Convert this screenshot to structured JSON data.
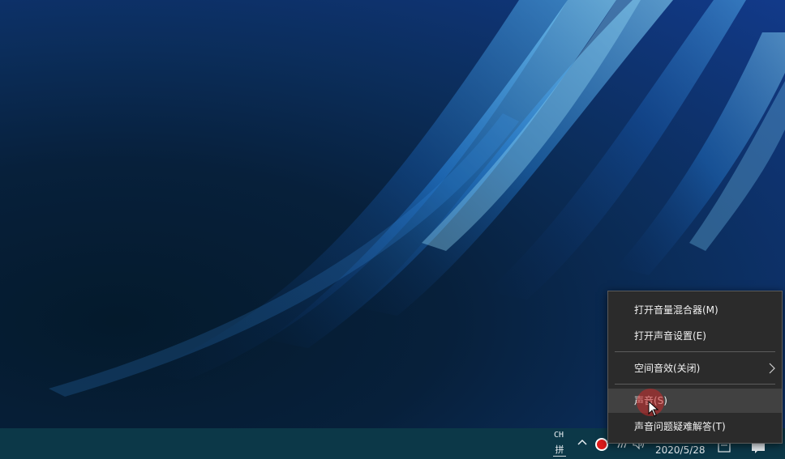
{
  "menu": {
    "items": [
      {
        "label": "打开音量混合器(M)"
      },
      {
        "label": "打开声音设置(E)"
      },
      {
        "label": "空间音效(关闭)"
      },
      {
        "label": "声音(S)"
      },
      {
        "label": "声音问题疑难解答(T)"
      }
    ]
  },
  "tray": {
    "ime_lang": "CH",
    "ime_mode": "拼",
    "time": "",
    "date": "2020/5/28"
  },
  "icons": {
    "chevron": "chevron-up-icon",
    "record": "record-icon",
    "network": "network-icon",
    "volume": "volume-icon",
    "note": "note-icon",
    "notifications": "notification-icon",
    "submenu": "chevron-right-icon",
    "cursor": "mouse-pointer-icon"
  },
  "colors": {
    "menu_bg": "#2b2b2b",
    "menu_hover": "#414141",
    "taskbar": "#0c3848",
    "record": "#e01b1b"
  }
}
